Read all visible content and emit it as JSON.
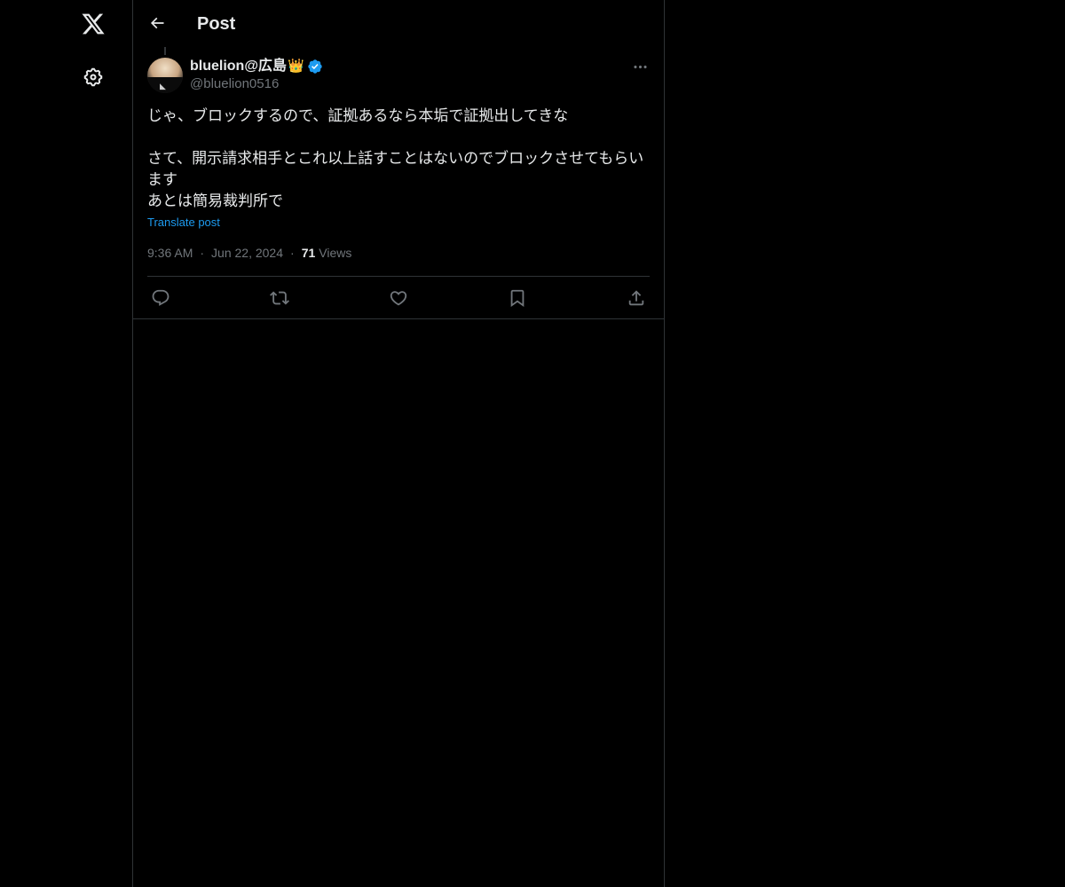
{
  "nav": {
    "logo_icon": "x-logo-icon",
    "settings_icon": "gear-icon"
  },
  "header": {
    "title": "Post",
    "back_icon": "arrow-left-icon"
  },
  "post": {
    "author": {
      "display_name": "bluelion@広島",
      "badge_emoji": "👑",
      "handle": "@bluelion0516",
      "verified": true,
      "verified_color": "#1d9bf0"
    },
    "text": "じゃ、ブロックするので、証拠あるなら本垢で証拠出してきな\n\nさて、開示請求相手とこれ以上話すことはないのでブロックさせてもらいます\nあとは簡易裁判所で",
    "translate_label": "Translate post",
    "time": "9:36 AM",
    "date": "Jun 22, 2024",
    "separator": "·",
    "views_count": "71",
    "views_label": "Views"
  },
  "actions": {
    "reply_icon": "reply-icon",
    "repost_icon": "repost-icon",
    "like_icon": "heart-icon",
    "bookmark_icon": "bookmark-icon",
    "share_icon": "share-icon"
  },
  "colors": {
    "background": "#000000",
    "text_primary": "#e7e9ea",
    "text_secondary": "#71767b",
    "accent": "#1d9bf0",
    "border": "#2f3336"
  }
}
